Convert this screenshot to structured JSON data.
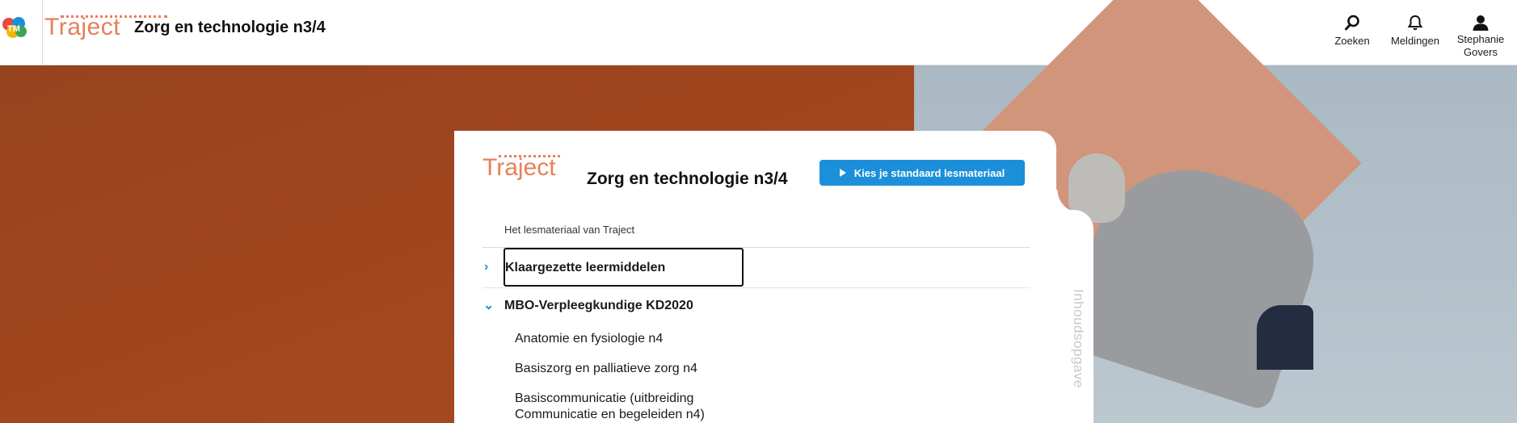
{
  "header": {
    "logo_text": "TM",
    "brand": "Traject",
    "title": "Zorg en technologie n3/4",
    "nav": {
      "search_label": "Zoeken",
      "notifications_label": "Meldingen",
      "user_first": "Stephanie",
      "user_last": "Govers"
    }
  },
  "card": {
    "brand": "Traject",
    "title": "Zorg en technologie n3/4",
    "primary_button": "Kies je standaard lesmateriaal",
    "section_label": "Het lesmateriaal van Traject",
    "tree": {
      "prepared": "Klaargezette leermiddelen",
      "course": "MBO-Verpleegkundige KD2020",
      "children": [
        "Anatomie en fysiologie n4",
        "Basiszorg en palliatieve zorg n4",
        "Basiscommunicatie (uitbreiding Communicatie en begeleiden n4)"
      ]
    },
    "side_tab": "Inhoudsopgave"
  },
  "colors": {
    "brand_orange": "#e5805a",
    "accent_blue": "#1b8fd9",
    "hero_rust": "#a0461f"
  }
}
